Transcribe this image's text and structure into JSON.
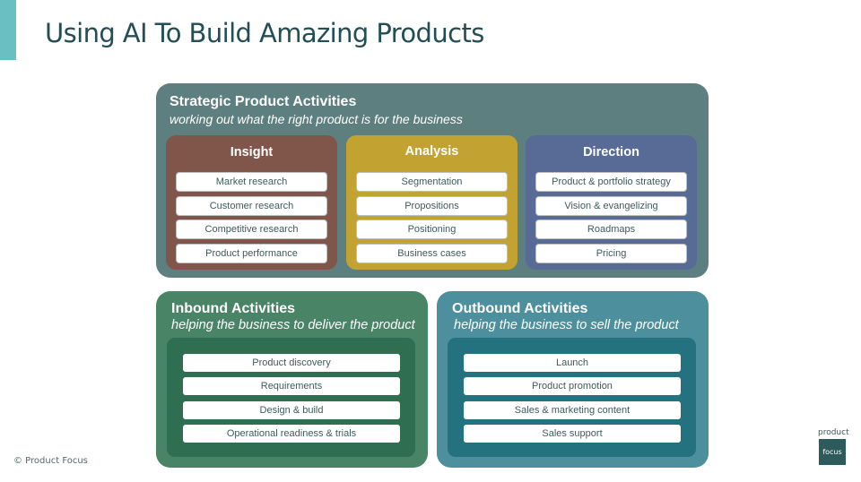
{
  "title": "Using AI To Build Amazing Products",
  "colors": {
    "accent_bar": "#6ABFC3",
    "title_text": "#234E55",
    "strategic": "#5E7F80",
    "insight": "#80564A",
    "analysis": "#C2A331",
    "direction": "#586B96",
    "inbound_outer": "#4A8466",
    "inbound_inner": "#2F6E50",
    "outbound_outer": "#4D8F9C",
    "outbound_inner": "#24717F"
  },
  "strategic": {
    "title": "Strategic Product Activities",
    "subtitle": "working out what the right product is for the business",
    "panels": [
      {
        "title": "Insight",
        "items": [
          "Market research",
          "Customer research",
          "Competitive research",
          "Product performance"
        ]
      },
      {
        "title": "Analysis",
        "items": [
          "Segmentation",
          "Propositions",
          "Positioning",
          "Business cases"
        ]
      },
      {
        "title": "Direction",
        "items": [
          "Product & portfolio strategy",
          "Vision & evangelizing",
          "Roadmaps",
          "Pricing"
        ]
      }
    ]
  },
  "inbound": {
    "title": "Inbound Activities",
    "subtitle": "helping the business to deliver the product",
    "items": [
      "Product discovery",
      "Requirements",
      "Design & build",
      "Operational readiness & trials"
    ]
  },
  "outbound": {
    "title": "Outbound Activities",
    "subtitle": "helping the business to sell the product",
    "items": [
      "Launch",
      "Product promotion",
      "Sales & marketing content",
      "Sales support"
    ]
  },
  "footer": {
    "copyright": "© Product Focus",
    "logo_top": "product",
    "logo_box": "focus"
  }
}
